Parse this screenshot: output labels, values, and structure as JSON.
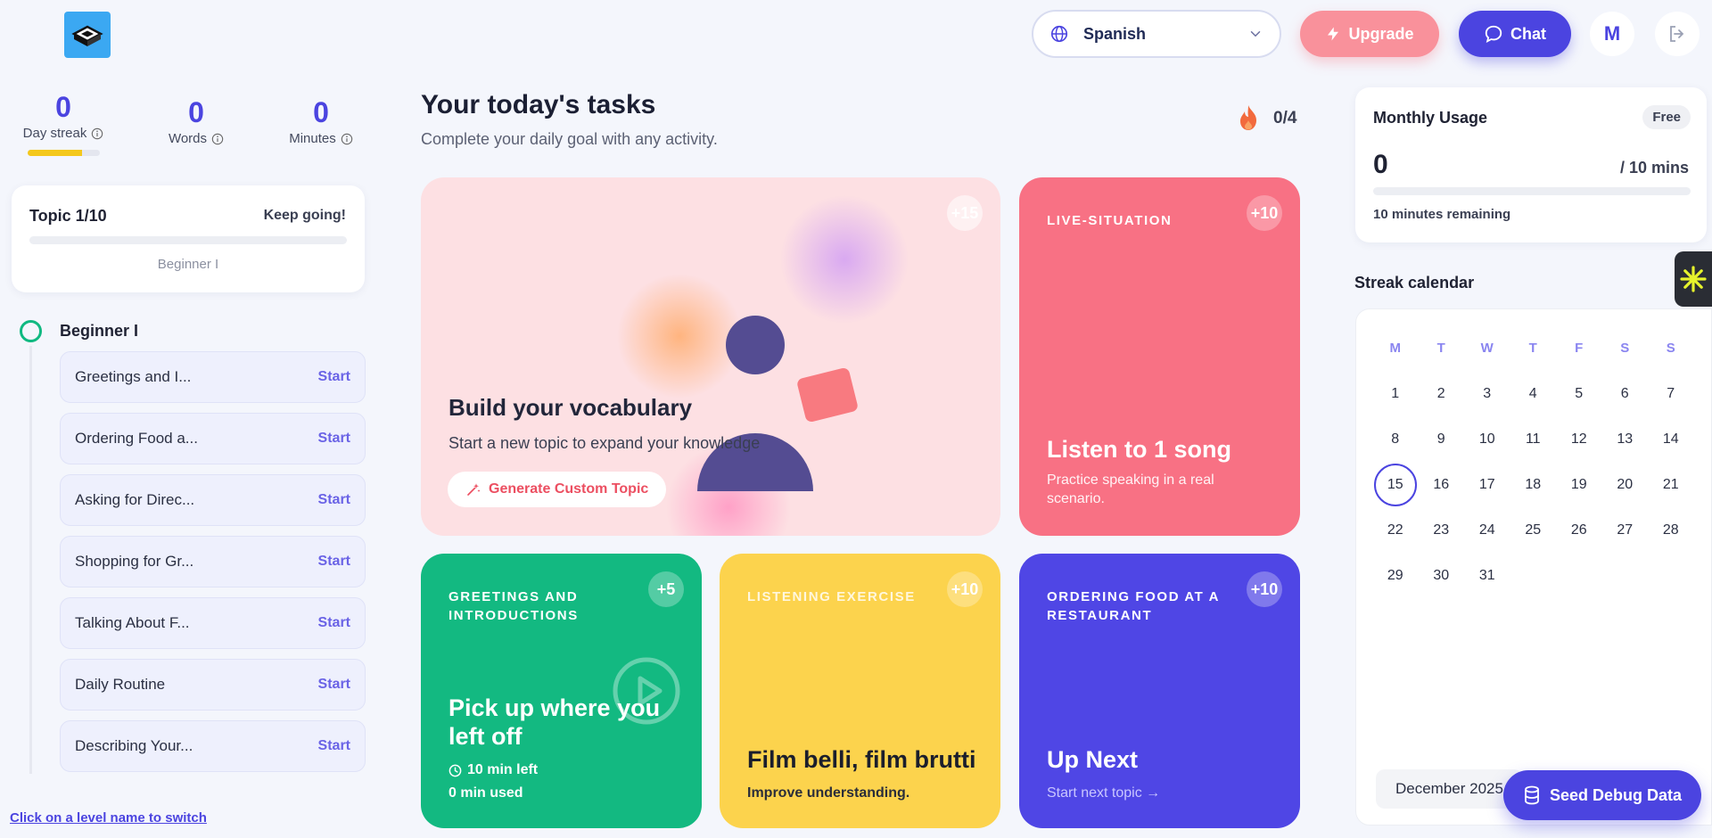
{
  "header": {
    "language": "Spanish",
    "upgrade_label": "Upgrade",
    "chat_label": "Chat",
    "avatar_initial": "M"
  },
  "stats": {
    "day_streak": {
      "value": "0",
      "label": "Day streak",
      "progress": 0.75
    },
    "words": {
      "value": "0",
      "label": "Words"
    },
    "minutes": {
      "value": "0",
      "label": "Minutes"
    }
  },
  "topic": {
    "title": "Topic 1/10",
    "encouragement": "Keep going!",
    "level": "Beginner I"
  },
  "level": {
    "name": "Beginner I",
    "lessons": [
      {
        "name": "Greetings and I...",
        "action": "Start"
      },
      {
        "name": "Ordering Food a...",
        "action": "Start"
      },
      {
        "name": "Asking for Direc...",
        "action": "Start"
      },
      {
        "name": "Shopping for Gr...",
        "action": "Start"
      },
      {
        "name": "Talking About F...",
        "action": "Start"
      },
      {
        "name": "Daily Routine",
        "action": "Start"
      },
      {
        "name": "Describing Your...",
        "action": "Start"
      }
    ],
    "switch_hint": "Click on a level name to switch"
  },
  "tasks": {
    "title": "Your today's tasks",
    "subtitle": "Complete your daily goal with any activity.",
    "progress": "0/4",
    "vocab": {
      "points": "+15",
      "title": "Build your vocabulary",
      "subtitle": "Start a new topic to expand your knowledge",
      "button": "Generate Custom Topic"
    },
    "live": {
      "kicker": "LIVE-SITUATION",
      "points": "+10",
      "title": "Listen to 1 song",
      "subtitle": "Practice speaking in a real scenario."
    },
    "continue": {
      "kicker": "GREETINGS AND INTRODUCTIONS",
      "points": "+5",
      "title": "Pick up where you left off",
      "time_left": "10 min left",
      "time_used": "0 min used"
    },
    "listening": {
      "kicker": "LISTENING EXERCISE",
      "points": "+10",
      "title": "Film belli, film brutti",
      "subtitle": "Improve understanding."
    },
    "next": {
      "kicker": "ORDERING FOOD AT A RESTAURANT",
      "points": "+10",
      "title": "Up Next",
      "subtitle": "Start next topic →"
    }
  },
  "usage": {
    "title": "Monthly Usage",
    "plan": "Free",
    "value": "0",
    "max": "/ 10 mins",
    "remaining": "10 minutes remaining"
  },
  "calendar": {
    "title": "Streak calendar",
    "weekdays": [
      "M",
      "T",
      "W",
      "T",
      "F",
      "S",
      "S"
    ],
    "days": [
      1,
      2,
      3,
      4,
      5,
      6,
      7,
      8,
      9,
      10,
      11,
      12,
      13,
      14,
      15,
      16,
      17,
      18,
      19,
      20,
      21,
      22,
      23,
      24,
      25,
      26,
      27,
      28,
      29,
      30,
      31
    ],
    "today": 15,
    "month": "December 2025"
  },
  "debug": {
    "seed_label": "Seed Debug Data"
  },
  "colors": {
    "primary": "#4b44e0",
    "coral": "#f87184",
    "green": "#13b981",
    "yellow": "#fcd34d",
    "purple": "#4f46e5"
  }
}
